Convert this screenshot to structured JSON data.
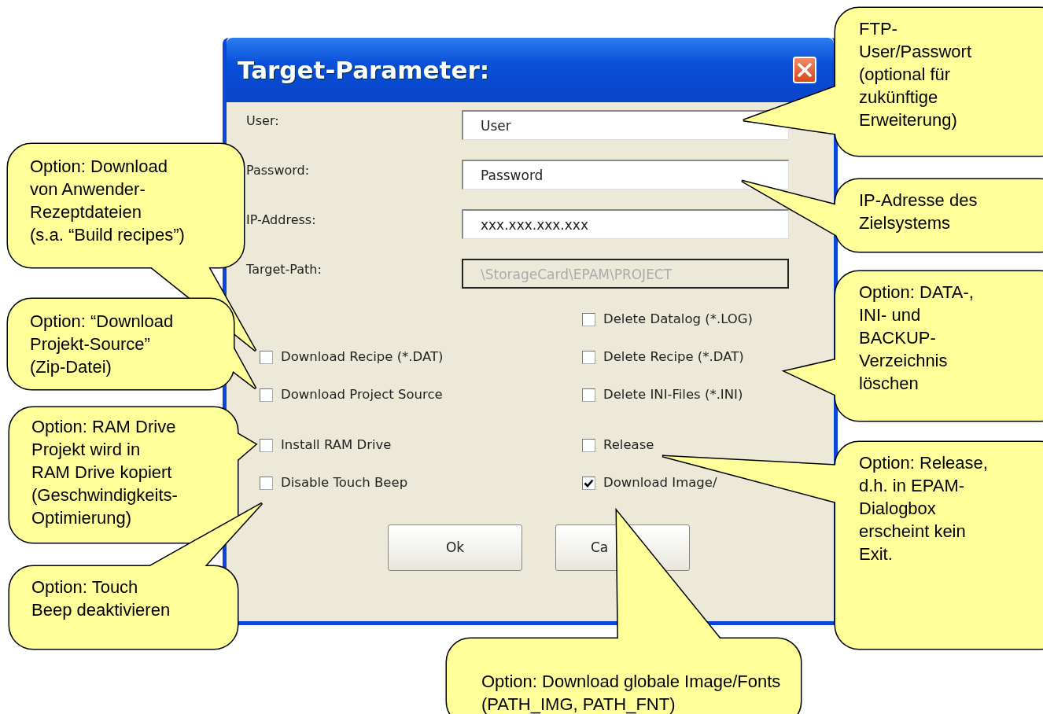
{
  "window": {
    "title": "Target-Parameter:"
  },
  "fields": [
    {
      "label": "User:",
      "value": "User",
      "disabled": false
    },
    {
      "label": "Password:",
      "value": "Password",
      "disabled": false
    },
    {
      "label": "IP-Address:",
      "value": "xxx.xxx.xxx.xxx",
      "disabled": false
    },
    {
      "label": "Target-Path:",
      "value": "\\StorageCard\\EPAM\\PROJECT",
      "disabled": true
    }
  ],
  "options_left": [
    {
      "label": "Download Recipe (*.DAT)",
      "checked": false
    },
    {
      "label": "Download Project Source",
      "checked": false
    },
    {
      "label": "Install RAM Drive",
      "checked": false
    },
    {
      "label": "Disable Touch Beep",
      "checked": false
    }
  ],
  "options_right": [
    {
      "label": "Delete Datalog (*.LOG)",
      "checked": false
    },
    {
      "label": "Delete Recipe (*.DAT)",
      "checked": false
    },
    {
      "label": "Delete INI-Files (*.INI)",
      "checked": false
    },
    {
      "label": "Release",
      "checked": false
    },
    {
      "label": "Download Image/",
      "checked": true
    }
  ],
  "buttons": [
    "Ok",
    "Ca"
  ],
  "callouts": [
    {
      "text": "FTP-\nUser/Passwort\n(optional für\nzukünftige\nErweiterung)"
    },
    {
      "text": "IP-Adresse des\nZielsystems"
    },
    {
      "text": "Option: DATA-,\nINI- und\nBACKUP-\nVerzeichnis\nlöschen"
    },
    {
      "text": "Option: Release,\nd.h. in EPAM-\nDialogbox\nerscheint kein\nExit."
    },
    {
      "text": "Option: Download\nvon Anwender-\nRezeptdateien\n(s.a. “Build recipes”)"
    },
    {
      "text": "Option: “Download\nProjekt-Source”\n(Zip-Datei)"
    },
    {
      "text": "Option: RAM Drive\nProjekt wird in\nRAM Drive kopiert\n(Geschwindigkeits-\nOptimierung)"
    },
    {
      "text": "Option: Touch\nBeep deaktivieren"
    },
    {
      "text": "Option: Download globale Image/Fonts\n(PATH_IMG, PATH_FNT)"
    }
  ]
}
